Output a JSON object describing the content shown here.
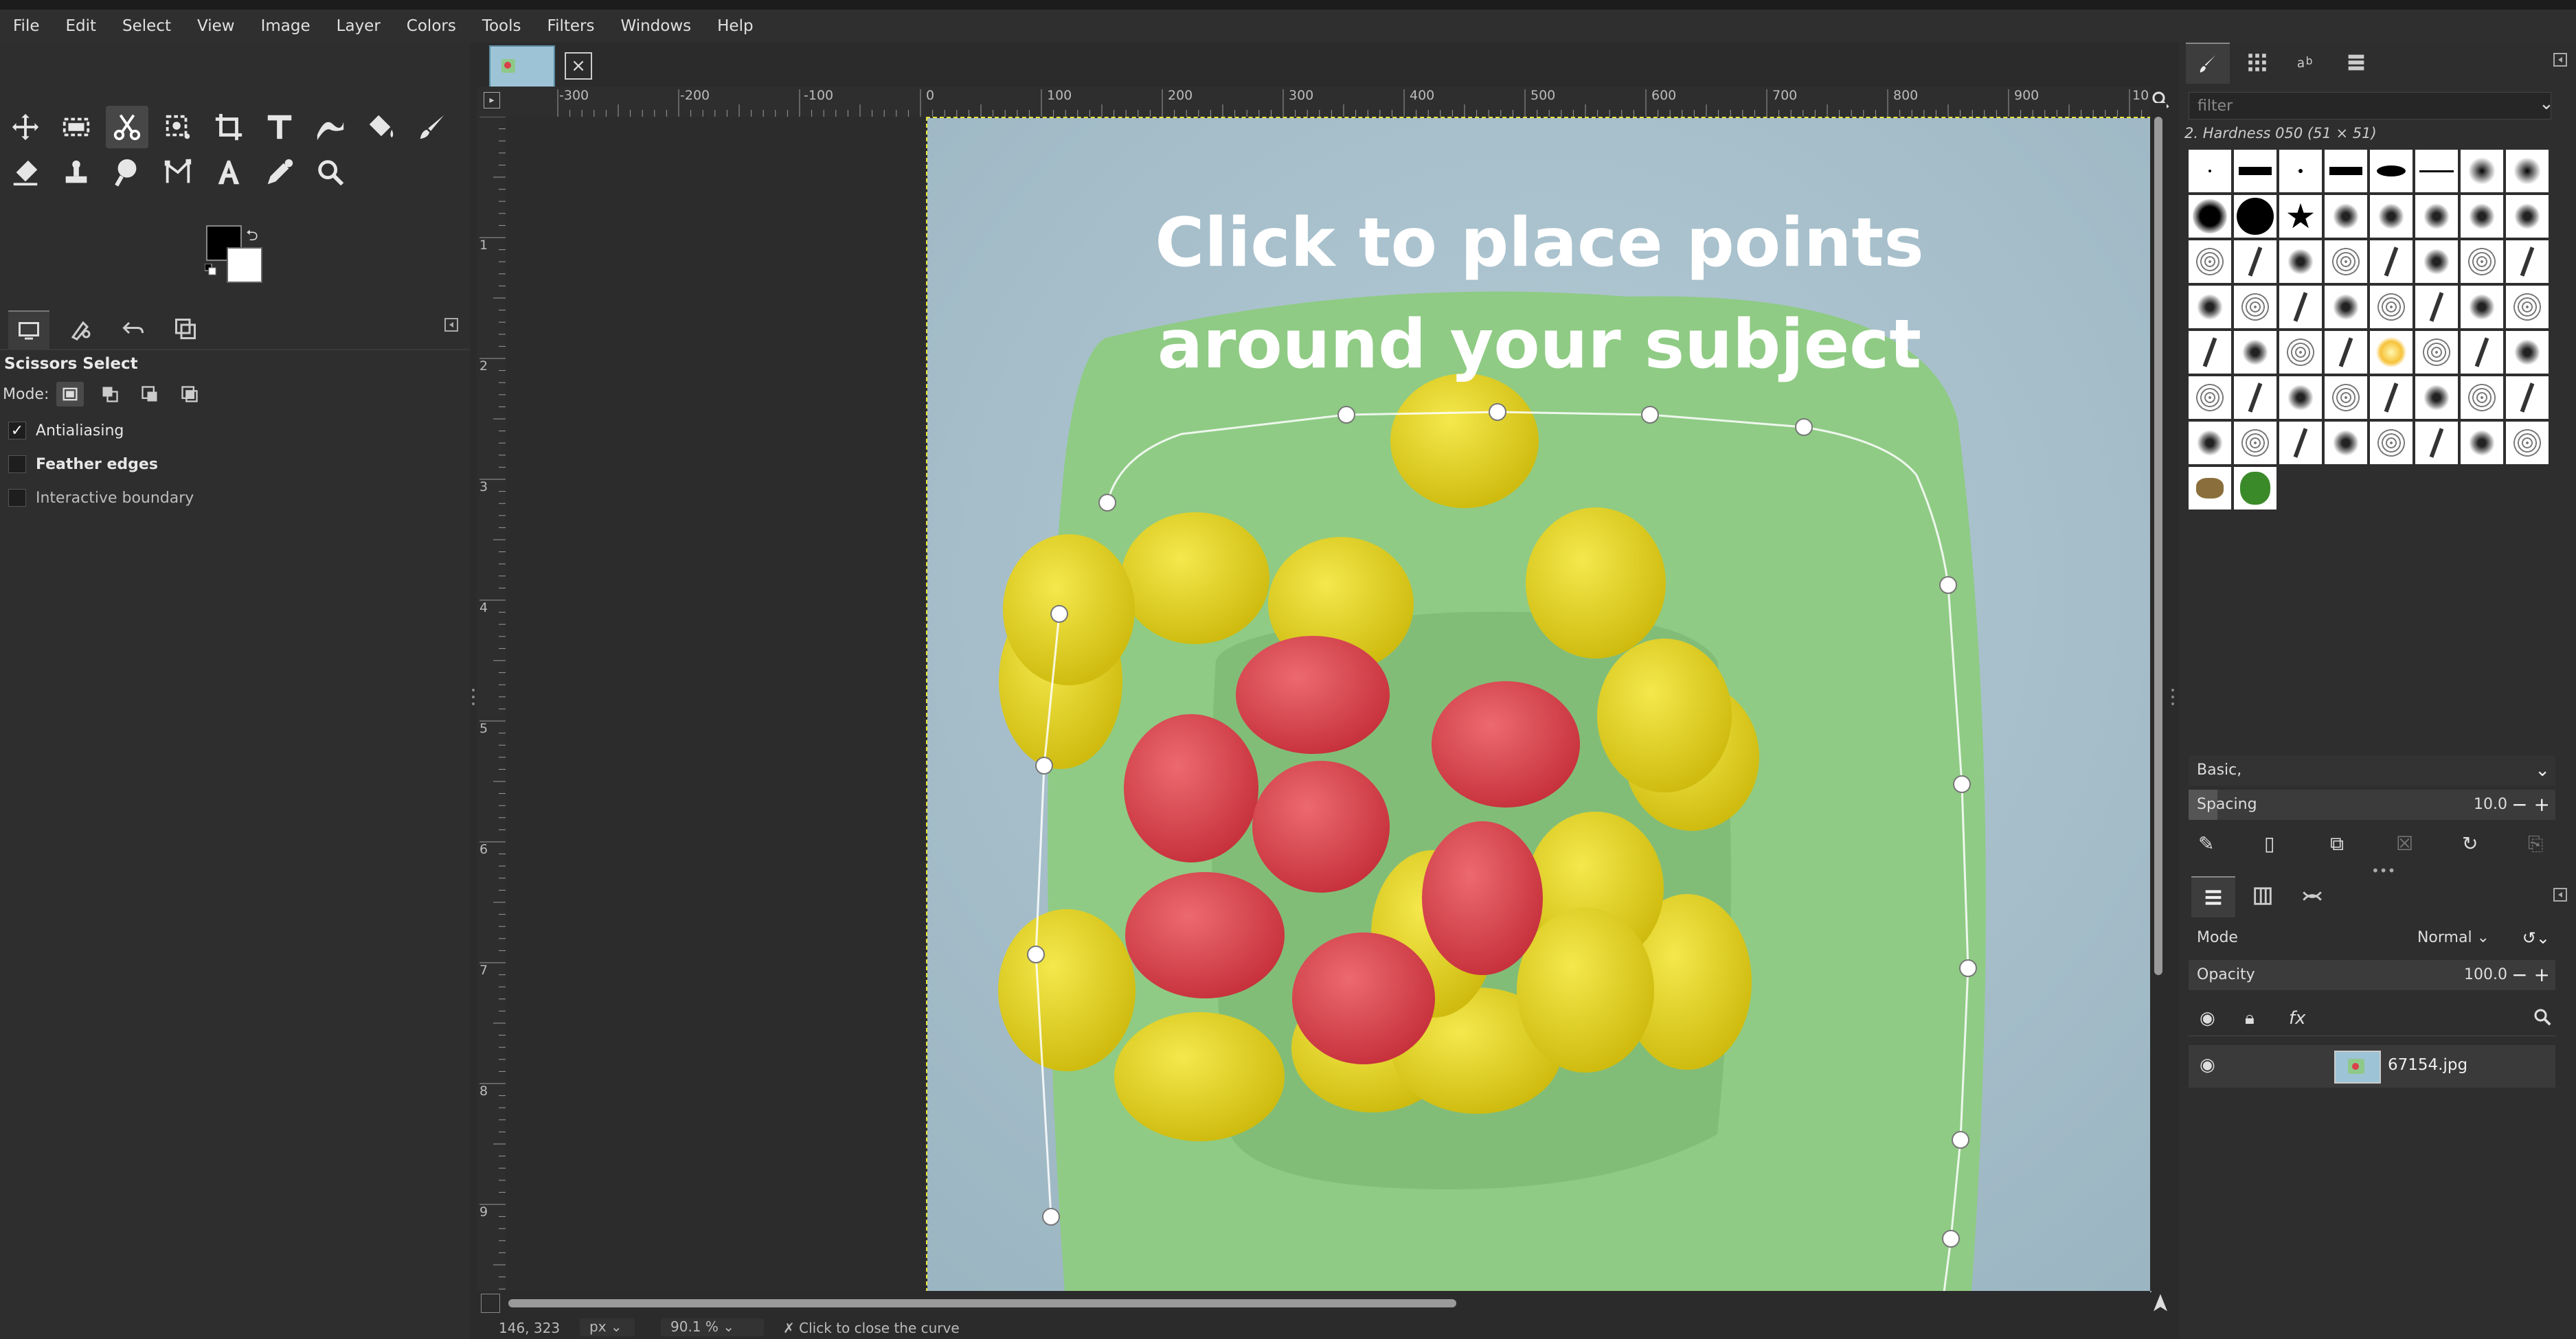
{
  "menu": [
    "File",
    "Edit",
    "Select",
    "View",
    "Image",
    "Layer",
    "Colors",
    "Tools",
    "Filters",
    "Windows",
    "Help"
  ],
  "tool_options": {
    "title": "Scissors Select",
    "mode_label": "Mode:",
    "antialiasing": "Antialiasing",
    "feather_edges": "Feather edges",
    "interactive_boundary": "Interactive boundary"
  },
  "rulers": {
    "top_labels": [
      "-300",
      "-200",
      "-100",
      "0",
      "100",
      "200",
      "300",
      "400",
      "500",
      "600",
      "700",
      "800",
      "900",
      "10"
    ],
    "left_labels": [
      "1",
      "2",
      "3",
      "4",
      "5",
      "6",
      "7",
      "8",
      "9"
    ]
  },
  "overlay": {
    "line1": "Click to place points",
    "line2": "around your subject"
  },
  "status": {
    "coords": "146, 323",
    "unit": "px",
    "zoom": "90.1 %",
    "message": "Click to close the curve"
  },
  "brushes": {
    "filter_placeholder": "filter",
    "selected_name": "2. Hardness 050 (51 × 51)"
  },
  "paint_dynamics": {
    "preset": "Basic,",
    "spacing_label": "Spacing",
    "spacing_value": "10.0"
  },
  "layers": {
    "mode_label": "Mode",
    "mode_value": "Normal",
    "opacity_label": "Opacity",
    "opacity_value": "100.0",
    "layer_name": "67154.jpg"
  },
  "colors": {
    "fg": "#000000",
    "bg": "#ffffff",
    "plate": "#8ec98a",
    "wall": "#a9c2cd",
    "yellow": "#e5d21e",
    "red": "#d9404a"
  }
}
